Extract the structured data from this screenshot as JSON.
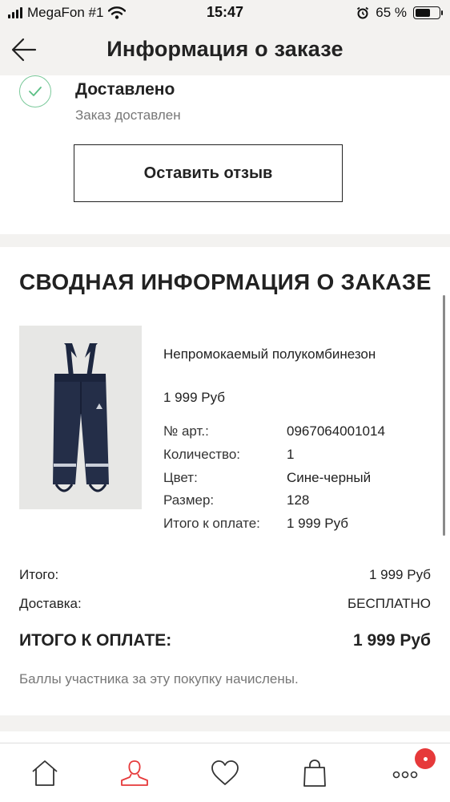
{
  "status_bar": {
    "carrier": "MegaFon #1",
    "time": "15:47",
    "battery": "65 %",
    "battery_level": 0.65
  },
  "header": {
    "title": "Информация о заказе",
    "back_icon": "arrow-left-icon"
  },
  "delivery": {
    "status_title": "Доставлено",
    "status_subtitle": "Заказ доставлен",
    "review_button": "Оставить отзыв",
    "check_color": "#5bbf85"
  },
  "summary": {
    "title": "СВОДНАЯ ИНФОРМАЦИЯ О ЗАКАЗЕ",
    "product": {
      "name": "Непромокаемый полукомбинезон",
      "price": "1 999 Руб",
      "details": [
        {
          "label": "№ арт.:",
          "value": "0967064001014"
        },
        {
          "label": "Количество:",
          "value": "1"
        },
        {
          "label": "Цвет:",
          "value": "Сине-черный"
        },
        {
          "label": "Размер:",
          "value": "128"
        },
        {
          "label": "Итого к оплате:",
          "value": "1 999 Руб"
        }
      ]
    },
    "totals": {
      "subtotal_label": "Итого:",
      "subtotal_value": "1 999 Руб",
      "delivery_label": "Доставка:",
      "delivery_value": "БЕСПЛАТНО",
      "grand_label": "ИТОГО К ОПЛАТЕ:",
      "grand_value": "1 999 Руб"
    },
    "points_note": "Баллы участника за эту покупку начислены."
  },
  "bottom_nav": {
    "items": [
      "home-icon",
      "profile-icon",
      "heart-icon",
      "shopping-bag-icon",
      "more-icon"
    ],
    "active": "profile-icon",
    "accent": "#e6393a"
  }
}
